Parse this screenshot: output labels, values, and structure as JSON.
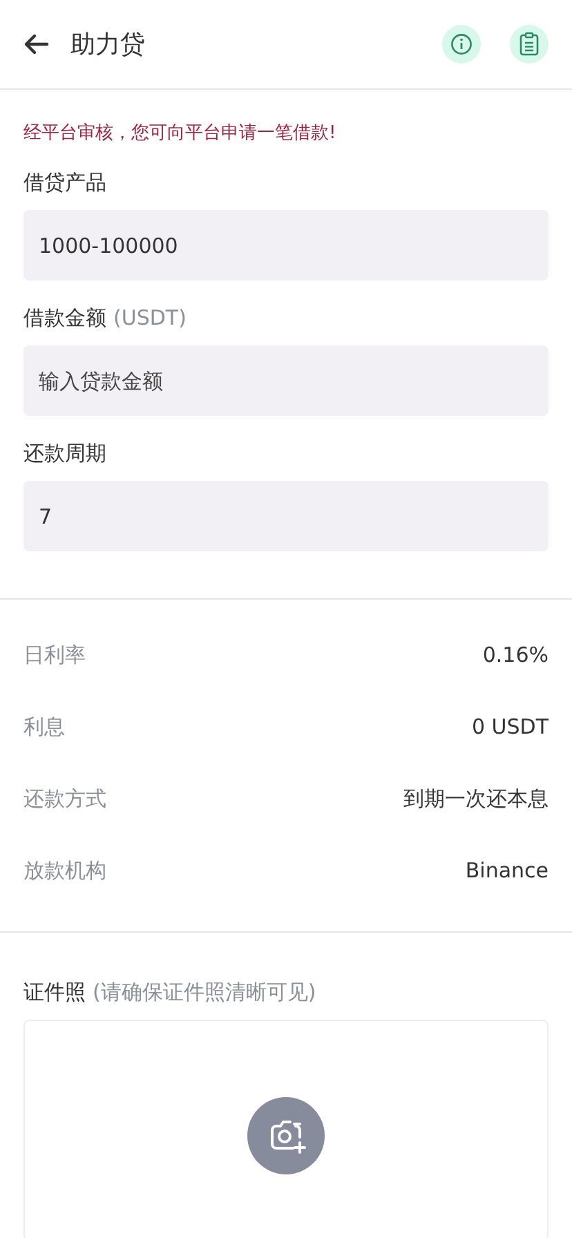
{
  "header": {
    "title": "助力贷"
  },
  "notice": "经平台审核，您可向平台申请一笔借款!",
  "fields": [
    {
      "label": "借贷产品",
      "value": "1000-100000"
    },
    {
      "label": "借款金额",
      "note": "(USDT)",
      "placeholder": "输入贷款金额"
    },
    {
      "label": "还款周期",
      "value": "7"
    }
  ],
  "details": [
    {
      "label": "日利率",
      "value": "0.16%"
    },
    {
      "label": "利息",
      "value": "0 USDT"
    },
    {
      "label": "还款方式",
      "value": "到期一次还本息"
    },
    {
      "label": "放款机构",
      "value": "Binance"
    }
  ],
  "upload": {
    "label": "证件照",
    "note": "(请确保证件照清晰可见)"
  }
}
